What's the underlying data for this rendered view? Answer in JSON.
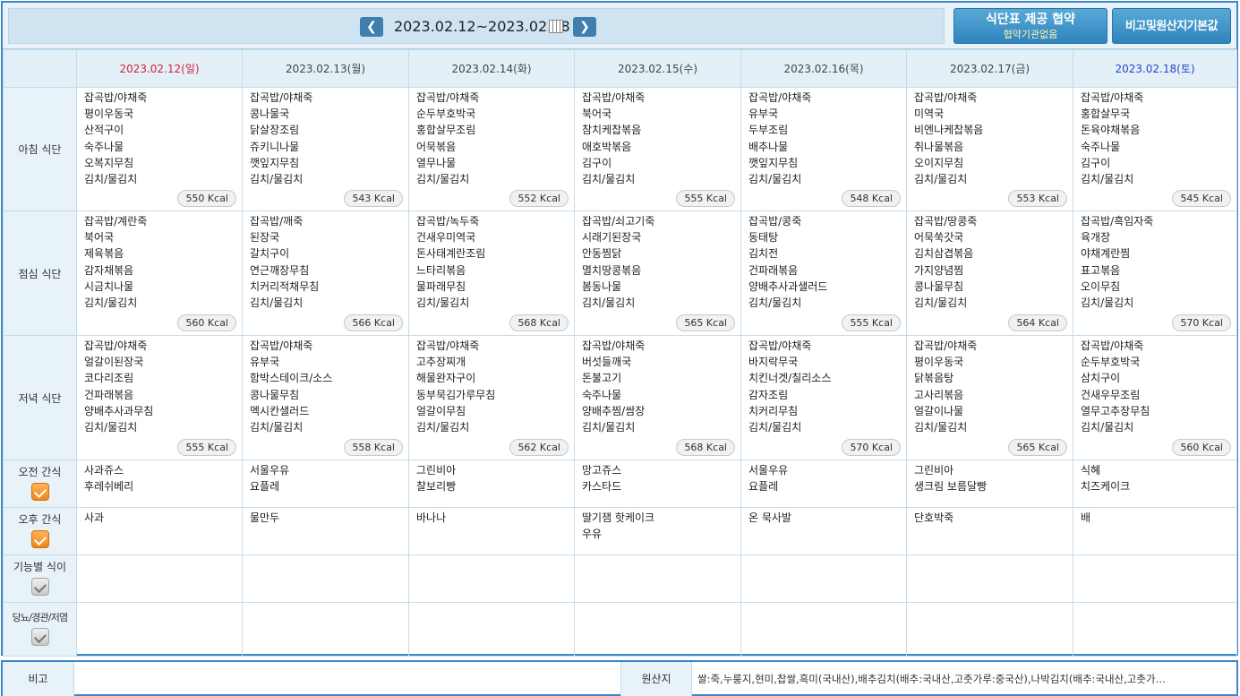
{
  "header": {
    "date_range": "2023.02.12~2023.02.18",
    "prev_glyph": "❮",
    "next_glyph": "❯",
    "agreement_button": {
      "title": "식단표 제공 협약",
      "subtitle": "협약기관없음"
    },
    "bigo_button": "비고및원산지기본값"
  },
  "days": [
    {
      "label": "2023.02.12(일)",
      "type": "sun"
    },
    {
      "label": "2023.02.13(월)",
      "type": ""
    },
    {
      "label": "2023.02.14(화)",
      "type": ""
    },
    {
      "label": "2023.02.15(수)",
      "type": ""
    },
    {
      "label": "2023.02.16(목)",
      "type": ""
    },
    {
      "label": "2023.02.17(금)",
      "type": ""
    },
    {
      "label": "2023.02.18(토)",
      "type": "sat"
    }
  ],
  "meals": [
    {
      "label": "아침 식단",
      "cells": [
        {
          "items": [
            "잡곡밥/야채죽",
            "평이우동국",
            "산적구이",
            "숙주나물",
            "오복지무침",
            "김치/물김치"
          ],
          "kcal": "550 Kcal"
        },
        {
          "items": [
            "잡곡밥/야채죽",
            "콩나물국",
            "닭살장조림",
            "쥬키니나물",
            "깻잎지무침",
            "김치/물김치"
          ],
          "kcal": "543 Kcal"
        },
        {
          "items": [
            "잡곡밥/야채죽",
            "순두부호박국",
            "홍합살무조림",
            "어묵볶음",
            "열무나물",
            "김치/물김치"
          ],
          "kcal": "552 Kcal"
        },
        {
          "items": [
            "잡곡밥/야채죽",
            "북어국",
            "참치케찹볶음",
            "애호박볶음",
            "김구이",
            "김치/물김치"
          ],
          "kcal": "555 Kcal"
        },
        {
          "items": [
            "잡곡밥/야채죽",
            "유부국",
            "두부조림",
            "배추나물",
            "깻잎지무침",
            "김치/물김치"
          ],
          "kcal": "548 Kcal"
        },
        {
          "items": [
            "잡곡밥/야채죽",
            "미역국",
            "비엔나케찹볶음",
            "취나물볶음",
            "오이지무침",
            "김치/물김치"
          ],
          "kcal": "553 Kcal"
        },
        {
          "items": [
            "잡곡밥/야채죽",
            "홍합살무국",
            "돈육야채볶음",
            "숙주나물",
            "김구이",
            "김치/물김치"
          ],
          "kcal": "545 Kcal"
        }
      ]
    },
    {
      "label": "점심 식단",
      "cells": [
        {
          "items": [
            "잡곡밥/계란죽",
            "북어국",
            "제육볶음",
            "감자채볶음",
            "시금치나물",
            "김치/물김치"
          ],
          "kcal": "560 Kcal"
        },
        {
          "items": [
            "잡곡밥/깨죽",
            "된장국",
            "갈치구이",
            "연근깨장무침",
            "치커리적채무침",
            "김치/물김치"
          ],
          "kcal": "566 Kcal"
        },
        {
          "items": [
            "잡곡밥/녹두죽",
            "건새우미역국",
            "돈사태계란조림",
            "느타리볶음",
            "물파래무침",
            "김치/물김치"
          ],
          "kcal": "568 Kcal"
        },
        {
          "items": [
            "잡곡밥/쇠고기죽",
            "시래기된장국",
            "안동찜닭",
            "멸치땅콩볶음",
            "봄동나물",
            "김치/물김치"
          ],
          "kcal": "565 Kcal"
        },
        {
          "items": [
            "잡곡밥/콩죽",
            "동태탕",
            "김치전",
            "건파래볶음",
            "양배추사과샐러드",
            "김치/물김치"
          ],
          "kcal": "555 Kcal"
        },
        {
          "items": [
            "잡곡밥/땅콩죽",
            "어묵쑥갓국",
            "김치삼겹볶음",
            "가지양념찜",
            "콩나물무침",
            "김치/물김치"
          ],
          "kcal": "564 Kcal"
        },
        {
          "items": [
            "잡곡밥/흑임자죽",
            "육개장",
            "야채계란찜",
            "표고볶음",
            "오이무침",
            "김치/물김치"
          ],
          "kcal": "570 Kcal"
        }
      ]
    },
    {
      "label": "저녁 식단",
      "cells": [
        {
          "items": [
            "잡곡밥/야채죽",
            "얼갈이된장국",
            "코다리조림",
            "건파래볶음",
            "양배추사과무침",
            "김치/물김치"
          ],
          "kcal": "555 Kcal"
        },
        {
          "items": [
            "잡곡밥/야채죽",
            "유부국",
            "함박스테이크/소스",
            "콩나물무침",
            "멕시칸샐러드",
            "김치/물김치"
          ],
          "kcal": "558 Kcal"
        },
        {
          "items": [
            "잡곡밥/야채죽",
            "고추장찌개",
            "해물완자구이",
            "동부묵김가루무침",
            "얼갈이무침",
            "김치/물김치"
          ],
          "kcal": "562 Kcal"
        },
        {
          "items": [
            "잡곡밥/야채죽",
            "버섯들깨국",
            "돈불고기",
            "숙주나물",
            "양배추찜/쌈장",
            "김치/물김치"
          ],
          "kcal": "568 Kcal"
        },
        {
          "items": [
            "잡곡밥/야채죽",
            "바지락무국",
            "치킨너겟/칠리소스",
            "감자조림",
            "치커리무침",
            "김치/물김치"
          ],
          "kcal": "570 Kcal"
        },
        {
          "items": [
            "잡곡밥/야채죽",
            "평이우동국",
            "닭볶음탕",
            "고사리볶음",
            "얼갈이나물",
            "김치/물김치"
          ],
          "kcal": "565 Kcal"
        },
        {
          "items": [
            "잡곡밥/야채죽",
            "순두부호박국",
            "삼치구이",
            "건새우무조림",
            "열무고추장무침",
            "김치/물김치"
          ],
          "kcal": "560 Kcal"
        }
      ]
    }
  ],
  "snacks": [
    {
      "label": "오전 간식",
      "checked": true,
      "cells": [
        [
          "사과쥬스",
          "후레쉬베리"
        ],
        [
          "서울우유",
          "요플레"
        ],
        [
          "그린비아",
          "찰보리빵"
        ],
        [
          "망고쥬스",
          "카스타드"
        ],
        [
          "서울우유",
          "요플레"
        ],
        [
          "그린비아",
          "생크림 보름달빵"
        ],
        [
          "식혜",
          "치즈케이크"
        ]
      ]
    },
    {
      "label": "오후 간식",
      "checked": true,
      "cells": [
        [
          "사과"
        ],
        [
          "물만두"
        ],
        [
          "바나나"
        ],
        [
          "딸기잼 핫케이크",
          "우유"
        ],
        [
          "온 묵사발"
        ],
        [
          "단호박죽"
        ],
        [
          "배"
        ]
      ]
    },
    {
      "label": "기능별 식이",
      "checked": false,
      "cells": [
        [],
        [],
        [],
        [],
        [],
        [],
        []
      ]
    },
    {
      "label": "당뇨/경관/저염",
      "checked": false,
      "cells": [
        [],
        [],
        [],
        [],
        [],
        [],
        []
      ]
    }
  ],
  "footer": {
    "bigo_label": "비고",
    "origin_label": "원산지",
    "origin_text": "쌀:죽,누룽지,현미,찹쌀,흑미(국내산),배추김치(배추:국내산,고춧가루:중국산),나박김치(배추:국내산,고춧가…"
  },
  "colors": {
    "border": "#3b88c8",
    "header_bg": "#e3f0f8",
    "sunday": "#d2233b",
    "saturday": "#2544c9",
    "check_on": "#f1841a"
  }
}
